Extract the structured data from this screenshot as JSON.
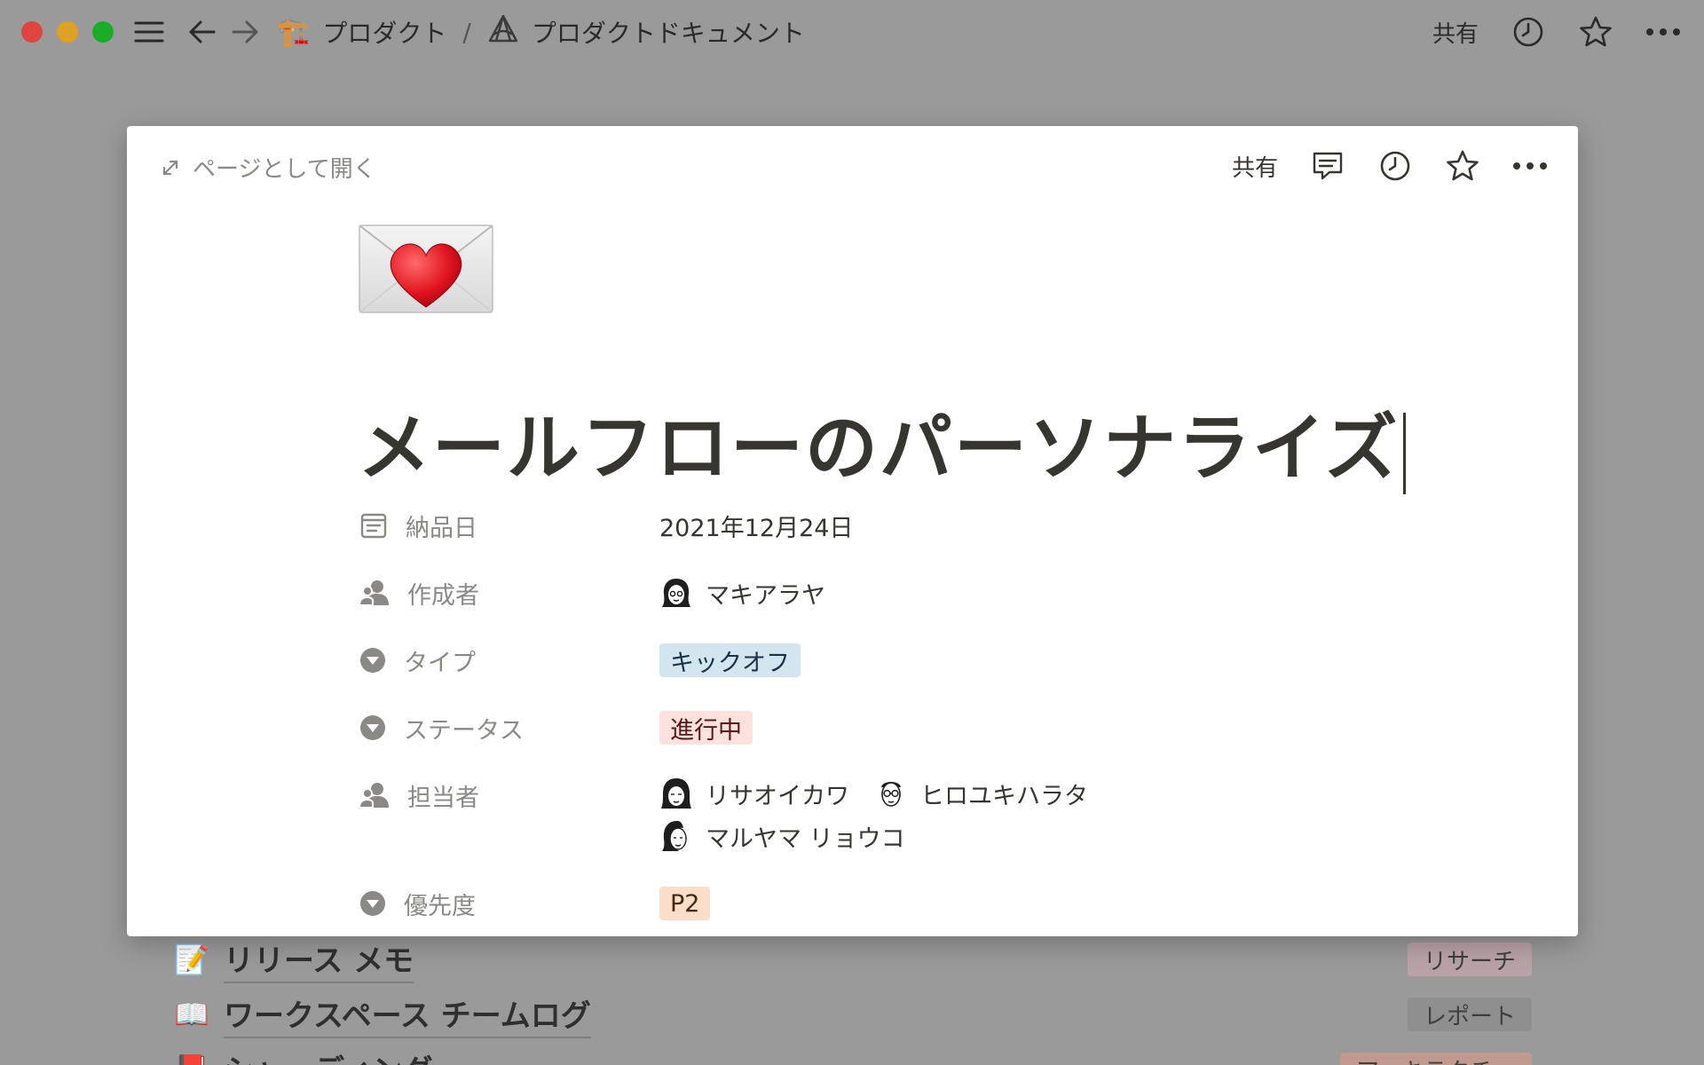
{
  "titlebar": {
    "crumbs": [
      {
        "emoji": "🏗️",
        "label": "プロダクト"
      },
      {
        "emoji": "🪐",
        "label": "プロダクトドキュメント"
      }
    ],
    "separator": "/",
    "share_label": "共有"
  },
  "background_list": [
    {
      "emoji": "📝",
      "title": "リリース メモ",
      "tag": "リサーチ",
      "tag_color": "#b9a3a8"
    },
    {
      "emoji": "📖",
      "title": "ワークスペース チームログ",
      "tag": "レポート",
      "tag_color": "#8f8f8f"
    },
    {
      "emoji": "📕",
      "title": "シャーディング",
      "tag": "アーキテクチャ",
      "tag_color": "#c19a8f"
    }
  ],
  "modal": {
    "open_as_page": "ページとして開く",
    "share_label": "共有",
    "page_emoji": "💌",
    "title": "メールフローのパーソナライズ",
    "properties": {
      "due": {
        "name": "納品日",
        "value": "2021年12月24日"
      },
      "creator": {
        "name": "作成者",
        "value": "マキアラヤ"
      },
      "type": {
        "name": "タイプ",
        "value": "キックオフ",
        "bg": "#d3e5ef",
        "fg": "#183347"
      },
      "status": {
        "name": "ステータス",
        "value": "進行中",
        "bg": "#ffe2dd",
        "fg": "#5d1715"
      },
      "assignees": {
        "name": "担当者",
        "people": [
          "リサオイカワ",
          "ヒロユキハラタ",
          "マルヤマ リョウコ"
        ]
      },
      "priority": {
        "name": "優先度",
        "value": "P2",
        "bg": "#fadec9",
        "fg": "#49290e"
      }
    }
  }
}
